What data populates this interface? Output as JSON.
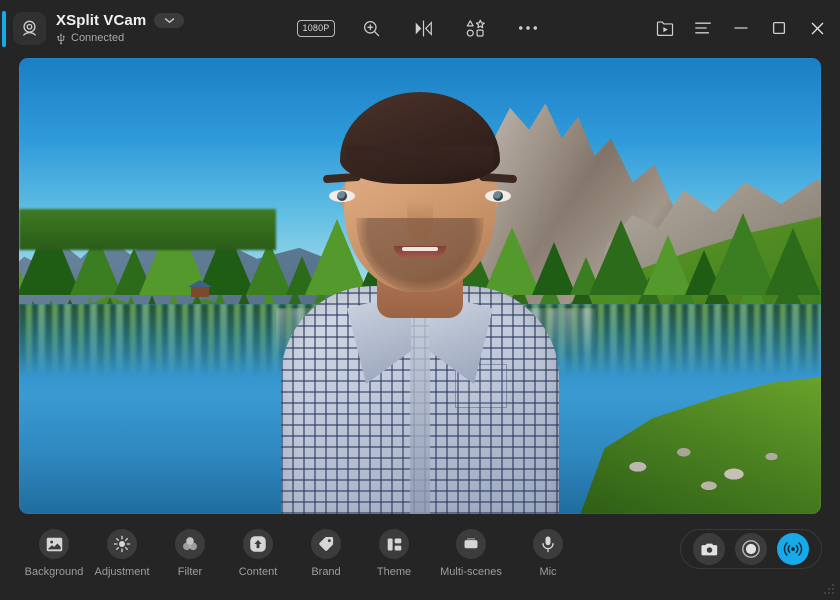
{
  "window": {
    "app_title": "XSplit VCam",
    "status_text": "Connected",
    "status_icon": "usb-icon",
    "app_icon": "webcam-icon",
    "dropdown_icon": "chevron-down-icon",
    "accent_color": "#17A9E8",
    "background_color": "#252525"
  },
  "titlebar_center": {
    "resolution_badge": "1080P",
    "items": [
      {
        "name": "zoom-in-icon",
        "label": "Zoom"
      },
      {
        "name": "mirror-icon",
        "label": "Mirror"
      },
      {
        "name": "shapes-icon",
        "label": "Effects"
      },
      {
        "name": "more-icon",
        "label": "More"
      }
    ]
  },
  "titlebar_right": {
    "items": [
      {
        "name": "media-folder-icon",
        "label": "Media"
      },
      {
        "name": "menu-icon",
        "label": "Menu"
      },
      {
        "name": "minimize-icon",
        "label": "Minimize"
      },
      {
        "name": "maximize-icon",
        "label": "Maximize"
      },
      {
        "name": "close-icon",
        "label": "Close"
      }
    ]
  },
  "preview": {
    "description": "Live camera preview: man in plaid shirt with alpine lake virtual background"
  },
  "toolbar": {
    "tools": [
      {
        "label": "Background",
        "icon": "image-icon"
      },
      {
        "label": "Adjustment",
        "icon": "brightness-icon"
      },
      {
        "label": "Filter",
        "icon": "filter-circles-icon"
      },
      {
        "label": "Content",
        "icon": "upload-arrow-icon"
      },
      {
        "label": "Brand",
        "icon": "tag-icon"
      },
      {
        "label": "Theme",
        "icon": "layout-icon"
      },
      {
        "label": "Multi-scenes",
        "icon": "scenes-icon"
      },
      {
        "label": "Mic",
        "icon": "microphone-icon"
      }
    ]
  },
  "actions": {
    "buttons": [
      {
        "name": "snapshot-button",
        "icon": "camera-icon",
        "active": false
      },
      {
        "name": "record-button",
        "icon": "record-circle-icon",
        "active": false
      },
      {
        "name": "broadcast-button",
        "icon": "broadcast-icon",
        "active": true
      }
    ],
    "active_color": "#17A9E8"
  }
}
